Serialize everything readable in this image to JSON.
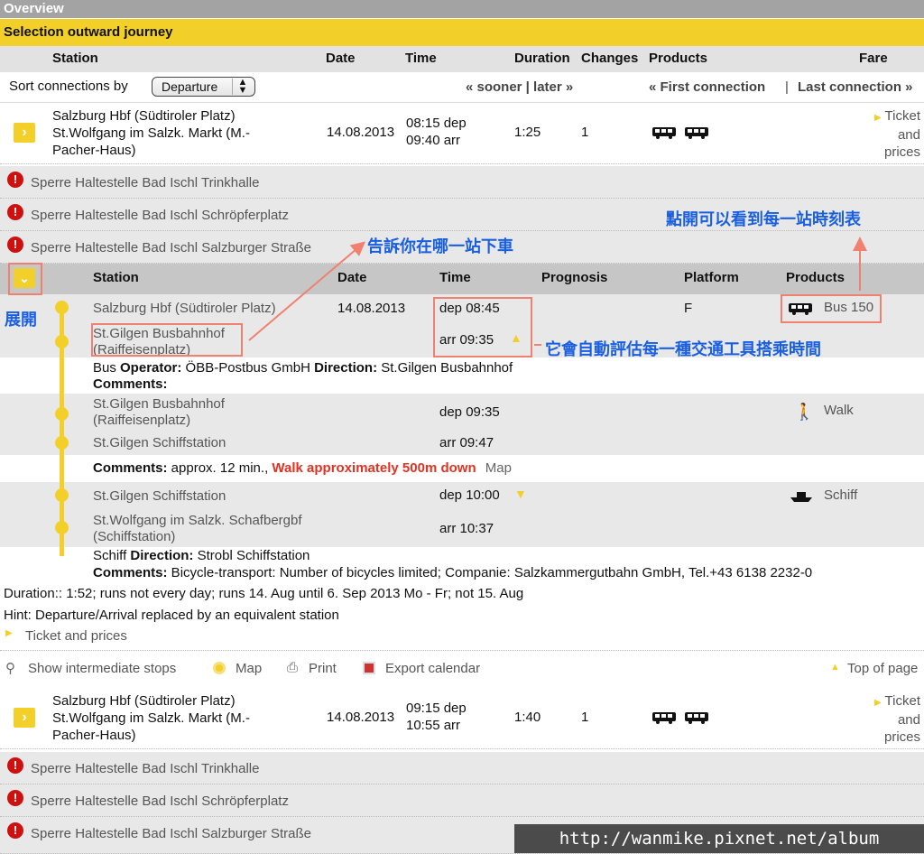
{
  "overview_title": "Overview",
  "section_title": "Selection outward journey",
  "columns": {
    "station": "Station",
    "date": "Date",
    "time": "Time",
    "duration": "Duration",
    "changes": "Changes",
    "products": "Products",
    "fare": "Fare"
  },
  "sort": {
    "label": "Sort connections by",
    "value": "Departure",
    "sooner_later": "« sooner | later »",
    "first": "« First connection",
    "sep": "|",
    "last": "Last connection »"
  },
  "connections": [
    {
      "station_lines": [
        "Salzburg Hbf (Südtiroler Platz)",
        "St.Wolfgang im Salzk. Markt (M.-",
        "Pacher-Haus)"
      ],
      "date": "14.08.2013",
      "dep": "08:15 dep",
      "arr": "09:40 arr",
      "duration": "1:25",
      "changes": "1",
      "fare": [
        "Ticket",
        "and",
        "prices"
      ]
    },
    {
      "station_lines": [
        "Salzburg Hbf (Südtiroler Platz)",
        "St.Wolfgang im Salzk. Markt (M.-",
        "Pacher-Haus)"
      ],
      "date": "14.08.2013",
      "dep": "09:15 dep",
      "arr": "10:55 arr",
      "duration": "1:40",
      "changes": "1",
      "fare": [
        "Ticket",
        "and",
        "prices"
      ]
    }
  ],
  "notices": [
    "Sperre Haltestelle Bad Ischl Trinkhalle",
    "Sperre Haltestelle Bad Ischl Schröpferplatz",
    "Sperre Haltestelle Bad Ischl Salzburger Straße"
  ],
  "details_header": {
    "station": "Station",
    "date": "Date",
    "time": "Time",
    "prognosis": "Prognosis",
    "platform": "Platform",
    "products": "Products"
  },
  "segments": [
    {
      "from": "Salzburg Hbf (Südtiroler Platz)",
      "from_date": "14.08.2013",
      "dep": "dep 08:45",
      "platform": "F",
      "product": "Bus 150",
      "to_lines": [
        "St.Gilgen Busbahnhof",
        "(Raiffeisenplatz)"
      ],
      "arr": "arr 09:35",
      "info_lines": {
        "label1": "Bus ",
        "k1": "Operator:",
        "v1": " ÖBB-Postbus GmbH ",
        "k2": "Direction:",
        "v2": " St.Gilgen Busbahnhof",
        "k3": "Comments:"
      }
    },
    {
      "from_lines": [
        "St.Gilgen Busbahnhof",
        "(Raiffeisenplatz)"
      ],
      "dep": "dep 09:35",
      "product": "Walk",
      "to": "St.Gilgen Schiffstation",
      "arr": "arr 09:47",
      "comments_key": "Comments:",
      "comments_val": " approx. 12 min.,",
      "walk_red": "Walk approximately 500m down",
      "map": "Map"
    },
    {
      "from": "St.Gilgen Schiffstation",
      "dep": "dep 10:00",
      "product": "Schiff",
      "to_lines": [
        "St.Wolfgang im Salzk. Schafbergbf",
        "(Schiffstation)"
      ],
      "arr": "arr 10:37",
      "info_label": "Schiff ",
      "dir_key": "Direction:",
      "dir_val": " Strobl Schiffstation",
      "comments_key": "Comments:",
      "comments_val": " Bicycle-transport: Number of bicycles limited; Companie: Salzkammergutbahn GmbH, Tel.+43 6138 2232-0"
    }
  ],
  "summary": {
    "duration": "Duration:: 1:52; runs not every day; runs 14. Aug until 6. Sep 2013 Mo - Fr; not 15. Aug",
    "hint": "Hint: Departure/Arrival replaced by an equivalent station",
    "ticket": "Ticket and prices"
  },
  "actions": {
    "intermediate": "Show intermediate stops",
    "map": "Map",
    "print": "Print",
    "export": "Export calendar",
    "top": "Top of page"
  },
  "annotations": {
    "expand": "展開",
    "get_off": "告訴你在哪一站下車",
    "timetable": "點開可以看到每一站時刻表",
    "estimate": "它會自動評估每一種交通工具搭乘時間"
  },
  "watermark": "http://wanmike.pixnet.net/album",
  "colors": {
    "accent": "#f3cf2a",
    "header": "#a3a3a3",
    "annotation": "#1a5fe0",
    "highlight_box": "#f08070",
    "alert": "#cc1111"
  }
}
